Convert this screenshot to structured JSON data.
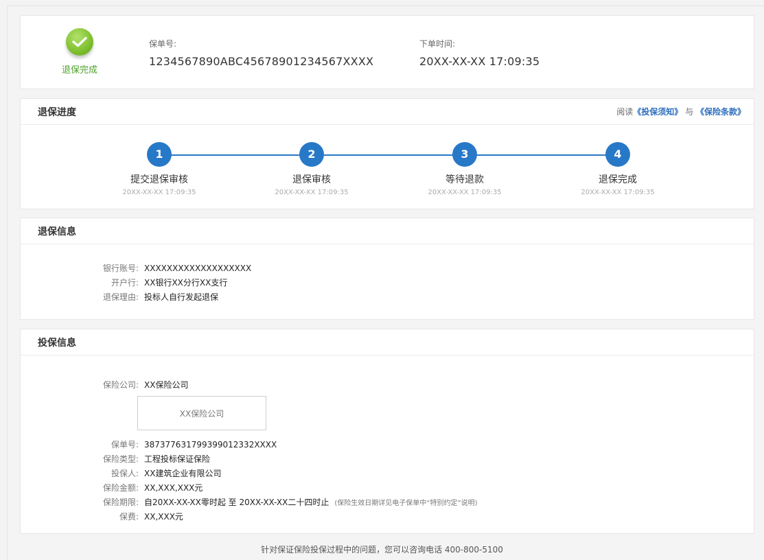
{
  "top": {
    "status": "退保完成",
    "policy_no_label": "保单号:",
    "policy_no": "1234567890ABC45678901234567XXXX",
    "order_time_label": "下单时间:",
    "order_time": "20XX-XX-XX 17:09:35"
  },
  "progress": {
    "title": "退保进度",
    "read_prefix": "阅读",
    "link_notice": "《投保须知》",
    "conj": "与",
    "link_terms": "《保险条款》",
    "steps": [
      {
        "num": "1",
        "label": "提交退保审核",
        "time": "20XX-XX-XX 17:09:35"
      },
      {
        "num": "2",
        "label": "退保审核",
        "time": "20XX-XX-XX 17:09:35"
      },
      {
        "num": "3",
        "label": "等待退款",
        "time": "20XX-XX-XX 17:09:35"
      },
      {
        "num": "4",
        "label": "退保完成",
        "time": "20XX-XX-XX 17:09:35"
      }
    ]
  },
  "refund": {
    "title": "退保信息",
    "rows": [
      {
        "label": "银行账号:",
        "value": "XXXXXXXXXXXXXXXXXXX"
      },
      {
        "label": "开户行:",
        "value": "XX银行XX分行XX支行"
      },
      {
        "label": "退保理由:",
        "value": "投标人自行发起退保"
      }
    ]
  },
  "policy": {
    "title": "投保信息",
    "company_label": "保险公司:",
    "company": "XX保险公司",
    "logo_text": "XX保险公司",
    "rows": [
      {
        "label": "保单号:",
        "value": "387377631799399012332XXXX"
      },
      {
        "label": "保险类型:",
        "value": "工程投标保证保险"
      },
      {
        "label": "投保人:",
        "value": "XX建筑企业有限公司"
      },
      {
        "label": "保险金额:",
        "value": "XX,XXX,XXX元"
      },
      {
        "label": "保险期限:",
        "value": "自20XX-XX-XX零时起 至 20XX-XX-XX二十四时止",
        "note": "(保险生效日期详见电子保单中“特别约定”说明)"
      },
      {
        "label": "保费:",
        "value": "XX,XXX元"
      }
    ]
  },
  "footer": "针对保证保险投保过程中的问题，您可以咨询电话 400-800-5100",
  "colors": {
    "accent": "#2878c8",
    "success": "#4ea12a"
  }
}
